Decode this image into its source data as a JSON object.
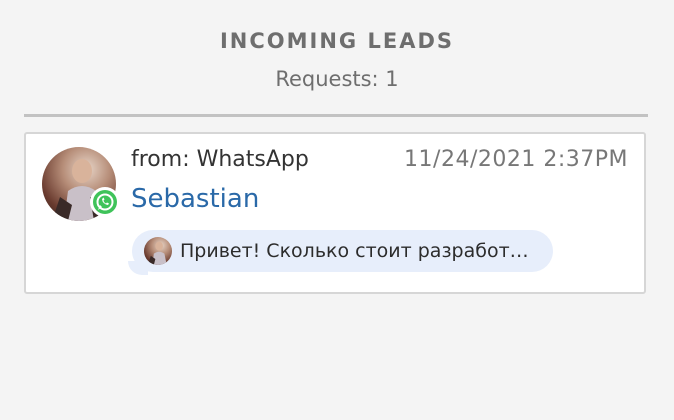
{
  "header": {
    "title": "INCOMING LEADS",
    "requests": "Requests: 1"
  },
  "leads": [
    {
      "source": "from: WhatsApp",
      "datetime": "11/24/2021 2:37PM",
      "name": "Sebastian",
      "message_preview": "Привет! Сколько стоит разработ…",
      "channel_icon": "whatsapp-icon"
    }
  ],
  "colors": {
    "background": "#f4f4f4",
    "name_link": "#2a69a8",
    "bubble": "#e7eefb",
    "whatsapp": "#3fc35a"
  }
}
